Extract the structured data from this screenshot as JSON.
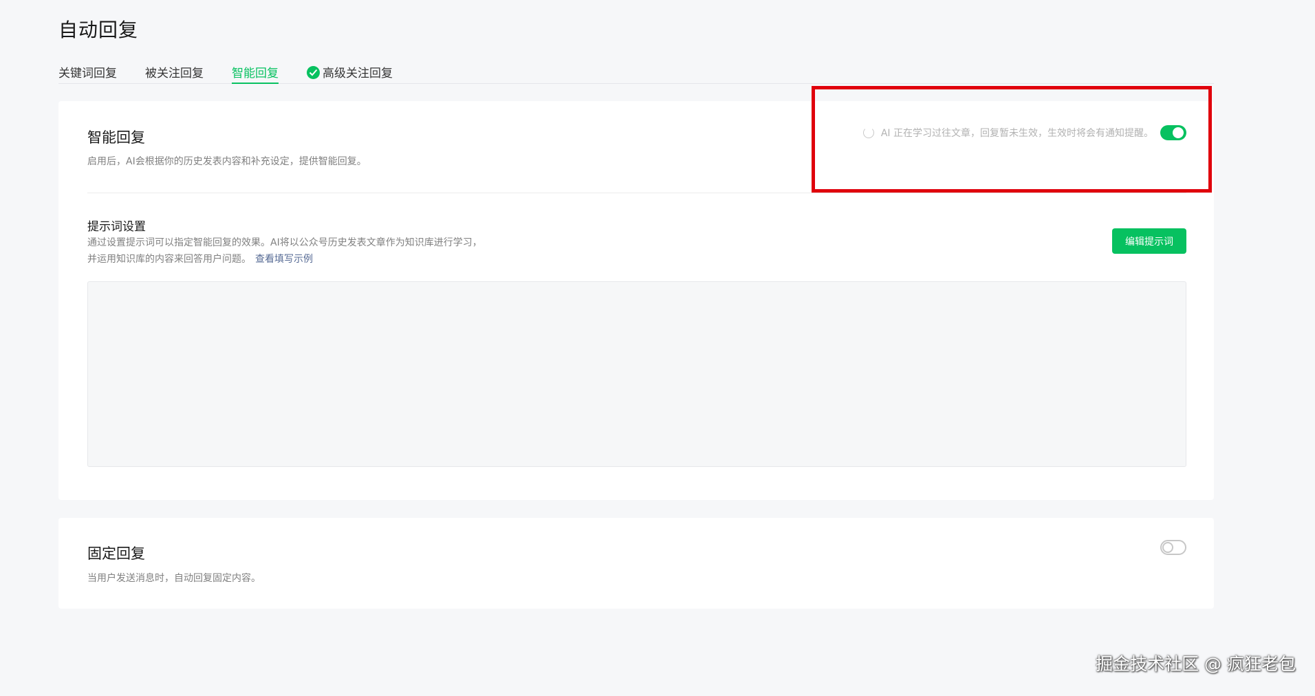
{
  "page": {
    "title": "自动回复"
  },
  "tabs": [
    {
      "label": "关键词回复",
      "active": false
    },
    {
      "label": "被关注回复",
      "active": false
    },
    {
      "label": "智能回复",
      "active": true
    },
    {
      "label": "高级关注回复",
      "active": false,
      "icon": "check-circle-icon"
    }
  ],
  "smart_reply": {
    "title": "智能回复",
    "description": "启用后，AI会根据你的历史发表内容和补充设定，提供智能回复。",
    "status_text": "AI 正在学习过往文章，回复暂未生效，生效时将会有通知提醒。",
    "enabled": true,
    "prompt": {
      "title": "提示词设置",
      "desc_line1": "通过设置提示词可以指定智能回复的效果。AI将以公众号历史发表文章作为知识库进行学习，",
      "desc_line2": "并运用知识库的内容来回答用户问题。",
      "example_link": "查看填写示例",
      "edit_button": "编辑提示词",
      "content": ""
    }
  },
  "fixed_reply": {
    "title": "固定回复",
    "description": "当用户发送消息时，自动回复固定内容。",
    "enabled": false
  },
  "watermark": "掘金技术社区 @ 疯狂老包",
  "colors": {
    "accent": "#07c160",
    "highlight": "#e0000c",
    "link": "#576b95"
  }
}
